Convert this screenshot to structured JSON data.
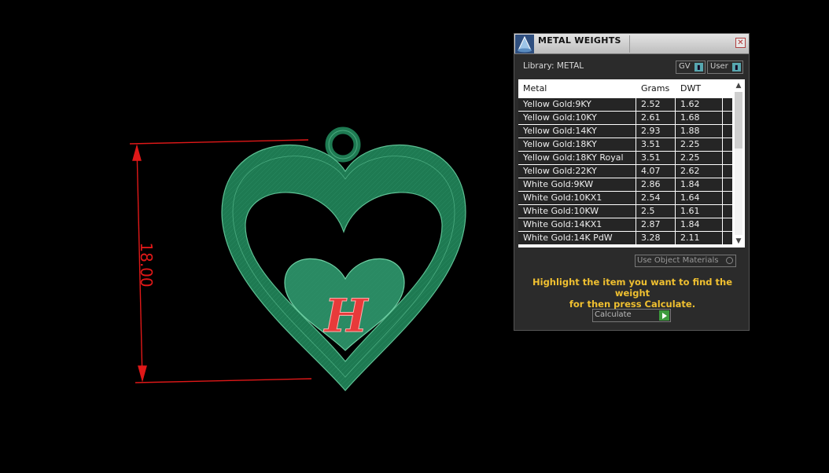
{
  "viewport": {
    "dimension_label": "18.00",
    "engraving_letter": "H",
    "colors": {
      "model": "#1e7a52",
      "dimension": "#e01818",
      "letter": "#e83a3a"
    }
  },
  "panel": {
    "title": "METAL WEIGHTS",
    "library_label": "Library: METAL",
    "gv_label": "GV",
    "user_label": "User",
    "columns": [
      "Metal",
      "Grams",
      "DWT"
    ],
    "rows": [
      [
        "Yellow Gold:9KY",
        "2.52",
        "1.62"
      ],
      [
        "Yellow Gold:10KY",
        "2.61",
        "1.68"
      ],
      [
        "Yellow Gold:14KY",
        "2.93",
        "1.88"
      ],
      [
        "Yellow Gold:18KY",
        "3.51",
        "2.25"
      ],
      [
        "Yellow Gold:18KY Royal",
        "3.51",
        "2.25"
      ],
      [
        "Yellow Gold:22KY",
        "4.07",
        "2.62"
      ],
      [
        "White Gold:9KW",
        "2.86",
        "1.84"
      ],
      [
        "White Gold:10KX1",
        "2.54",
        "1.64"
      ],
      [
        "White Gold:10KW",
        "2.5",
        "1.61"
      ],
      [
        "White Gold:14KX1",
        "2.87",
        "1.84"
      ],
      [
        "White Gold:14K PdW",
        "3.28",
        "2.11"
      ]
    ],
    "use_object_materials_label": "Use Object Materials",
    "hint_line1": "Highlight the item you want to find the weight",
    "hint_line2": "for then press Calculate.",
    "calculate_label": "Calculate",
    "colors": {
      "hint": "#f0c030",
      "accent": "#57a7b0",
      "go": "#3c9a3c"
    }
  }
}
